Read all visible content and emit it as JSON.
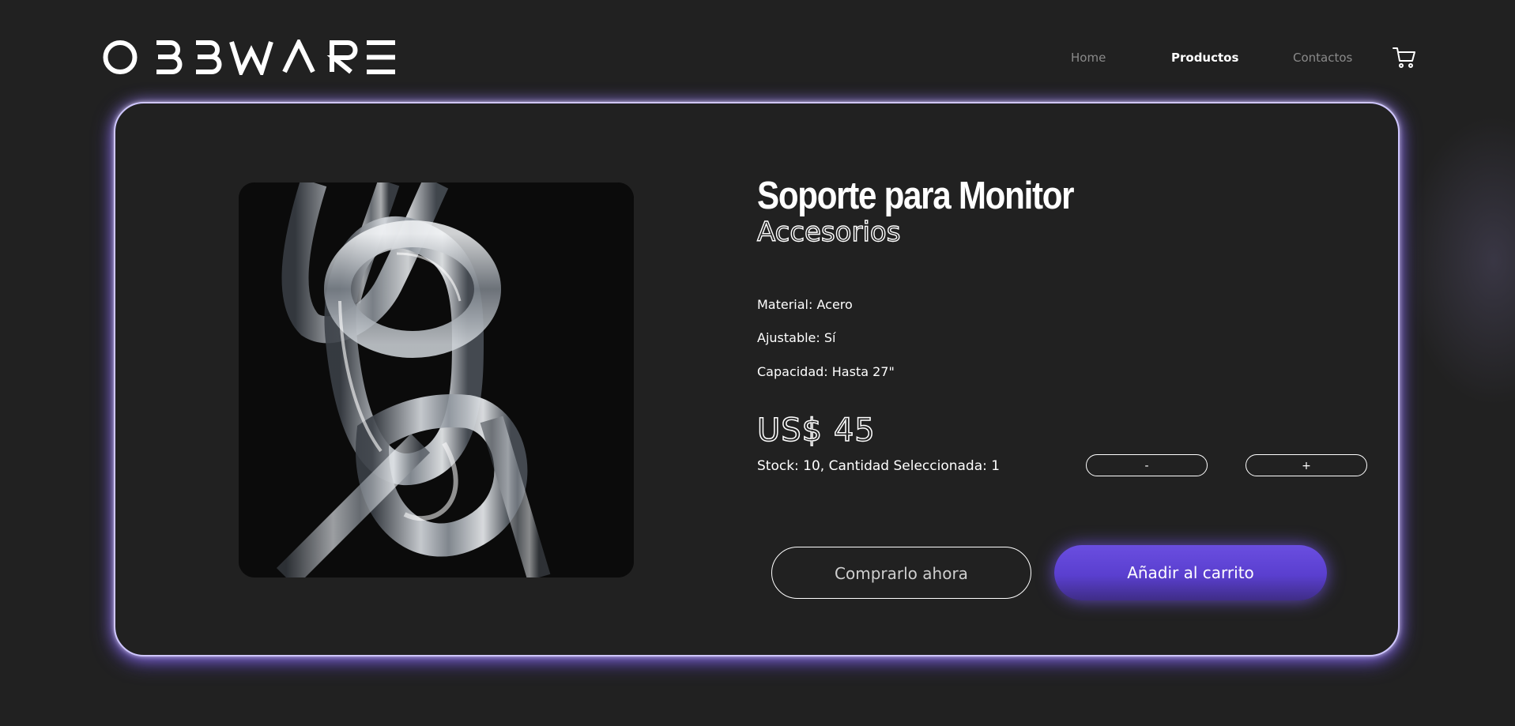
{
  "header": {
    "logo_text": "OBBWARE",
    "nav": [
      {
        "label": "Home",
        "active": false
      },
      {
        "label": "Productos",
        "active": true
      },
      {
        "label": "Contactos",
        "active": false
      }
    ],
    "cart_icon": "shopping-cart-icon"
  },
  "product": {
    "title": "Soporte para Monitor",
    "category": "Accesorios",
    "specs": [
      "Material: Acero",
      "Ajustable: Sí",
      "Capacidad: Hasta 27\""
    ],
    "price": "US$ 45",
    "stock_text": "Stock: 10, Cantidad Seleccionada: 1",
    "decrement_label": "-",
    "increment_label": "+",
    "buy_now_label": "Comprarlo ahora",
    "add_to_cart_label": "Añadir al carrito",
    "image_alt": "glass-chain-image"
  },
  "colors": {
    "background": "#212121",
    "accent": "#5a3fcf",
    "glow": "#6c4ce6",
    "text": "#ffffff",
    "nav_inactive": "#8a8a8a"
  }
}
